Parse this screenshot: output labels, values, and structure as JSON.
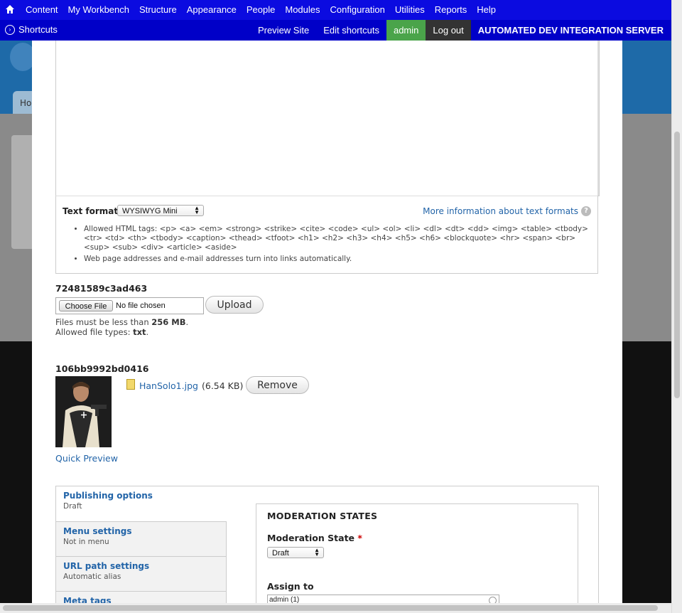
{
  "toolbar": {
    "menu": [
      "Content",
      "My Workbench",
      "Structure",
      "Appearance",
      "People",
      "Modules",
      "Configuration",
      "Utilities",
      "Reports",
      "Help"
    ]
  },
  "shortcuts": {
    "label": "Shortcuts",
    "preview_site": "Preview Site",
    "edit_shortcuts": "Edit shortcuts",
    "user": "admin",
    "logout": "Log out",
    "server": "AUTOMATED DEV INTEGRATION SERVER"
  },
  "background": {
    "tab_text": "Ho"
  },
  "text_format": {
    "label": "Text format",
    "selected": "WYSIWYG Mini",
    "more_info": "More information about text formats",
    "tips": [
      "Allowed HTML tags: <p> <a> <em> <strong> <strike> <cite> <code> <ul> <ol> <li> <dl> <dt> <dd> <img> <table> <tbody> <tr> <td> <th> <tbody> <caption> <thead> <tfoot> <h1> <h2> <h3> <h4> <h5> <h6> <blockquote> <hr> <span> <br> <sup> <sub> <div> <article> <aside>",
      "Web page addresses and e-mail addresses turn into links automatically."
    ]
  },
  "upload_field": {
    "label": "72481589c3ad463",
    "choose_file": "Choose File",
    "no_file": "No file chosen",
    "upload_button": "Upload",
    "size_prefix": "Files must be less than ",
    "size_value": "256 MB",
    "size_suffix": ".",
    "types_prefix": "Allowed file types: ",
    "types_value": "txt",
    "types_suffix": "."
  },
  "image_field": {
    "label": "106bb9992bd0416",
    "file_name": "HanSolo1.jpg",
    "file_size": "(6.54 KB)",
    "remove_button": "Remove",
    "quick_preview": "Quick Preview"
  },
  "vertical_tabs": [
    {
      "title": "Publishing options",
      "summary": "Draft"
    },
    {
      "title": "Menu settings",
      "summary": "Not in menu"
    },
    {
      "title": "URL path settings",
      "summary": "Automatic alias"
    },
    {
      "title": "Meta tags",
      "summary": ""
    }
  ],
  "moderation": {
    "heading": "MODERATION STATES",
    "state_label": "Moderation State",
    "required_mark": "*",
    "state_value": "Draft",
    "assign_label": "Assign to",
    "assign_value": "admin (1)"
  }
}
